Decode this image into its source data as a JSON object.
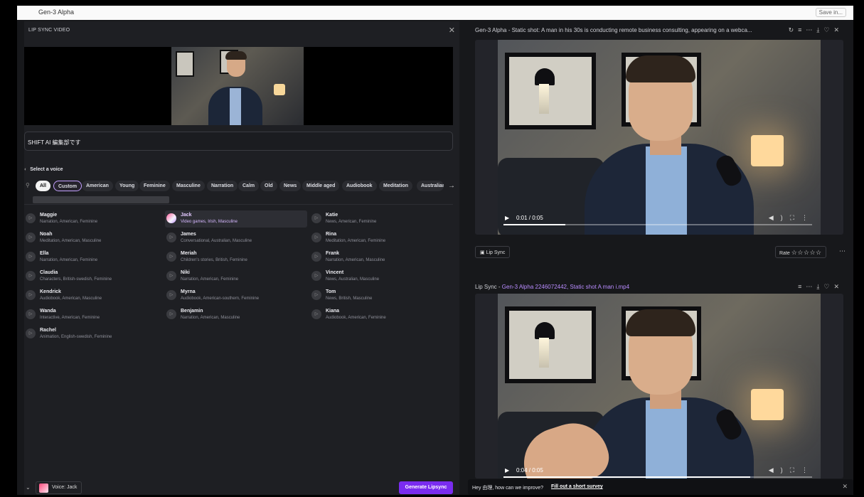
{
  "app": {
    "model_selector": "Gen-3 Alpha",
    "top_right_button": "Save in..."
  },
  "lip_sync_panel": {
    "title": "LIP SYNC VIDEO",
    "text_input_value": "SHIFT AI 編集部です",
    "select_voice_label": "Select a voice",
    "filters": [
      "All",
      "Custom",
      "American",
      "Young",
      "Feminine",
      "Masculine",
      "Narration",
      "Calm",
      "Old",
      "News",
      "Middle aged",
      "Audiobook",
      "Meditation",
      "Australian"
    ],
    "selected_filter": "All",
    "voices_col1": [
      {
        "name": "Maggie",
        "desc": "Narration, American, Feminine"
      },
      {
        "name": "Noah",
        "desc": "Meditation, American, Masculine"
      },
      {
        "name": "Ella",
        "desc": "Narration, American, Feminine"
      },
      {
        "name": "Claudia",
        "desc": "Characters, British-swedish, Feminine"
      },
      {
        "name": "Kendrick",
        "desc": "Audiobook, American, Masculine"
      },
      {
        "name": "Wanda",
        "desc": "Interactive, American, Feminine"
      },
      {
        "name": "Rachel",
        "desc": "Animation, English-swedish, Feminine"
      }
    ],
    "voices_col2": [
      {
        "name": "Jack",
        "desc": "Video games, Irish, Masculine"
      },
      {
        "name": "James",
        "desc": "Conversational, Australian, Masculine"
      },
      {
        "name": "Meriah",
        "desc": "Children's stories, British, Feminine"
      },
      {
        "name": "Niki",
        "desc": "Narration, American, Feminine"
      },
      {
        "name": "Myrna",
        "desc": "Audiobook, American-southern, Feminine"
      },
      {
        "name": "Benjamin",
        "desc": "Narration, American, Masculine"
      }
    ],
    "voices_col3": [
      {
        "name": "Katie",
        "desc": "News, American, Feminine"
      },
      {
        "name": "Rina",
        "desc": "Meditation, American, Feminine"
      },
      {
        "name": "Frank",
        "desc": "Narration, American, Masculine"
      },
      {
        "name": "Vincent",
        "desc": "News, Australian, Masculine"
      },
      {
        "name": "Tom",
        "desc": "News, British, Masculine"
      },
      {
        "name": "Kiana",
        "desc": "Audiobook, American, Feminine"
      }
    ],
    "selected_voice": "Jack",
    "voice_badge": "Voice: Jack",
    "generate_button": "Generate Lipsync"
  },
  "right_panel": {
    "clip1": {
      "title": "Gen-3 Alpha - Static shot: A man in his 30s is conducting remote business consulting, appearing on a webca...",
      "time": "0:01 / 0:05",
      "progress": 0.2,
      "lip_sync_button": "Lip Sync",
      "rate_label": "Rate",
      "stars": "☆☆☆☆☆"
    },
    "clip2": {
      "title_prefix": "Lip Sync - ",
      "title_highlight": "Gen-3 Alpha 2246072442, Static shot A man i.mp4",
      "time": "0:04 / 0:05",
      "progress": 0.8
    },
    "survey": {
      "text": "Hey 由理, how can we improve?",
      "link": "Fill out a short survey"
    }
  },
  "colors": {
    "accent_purple": "#7a2cf0",
    "highlight_purple": "#b98cff",
    "panel_bg": "#1e1f23"
  }
}
